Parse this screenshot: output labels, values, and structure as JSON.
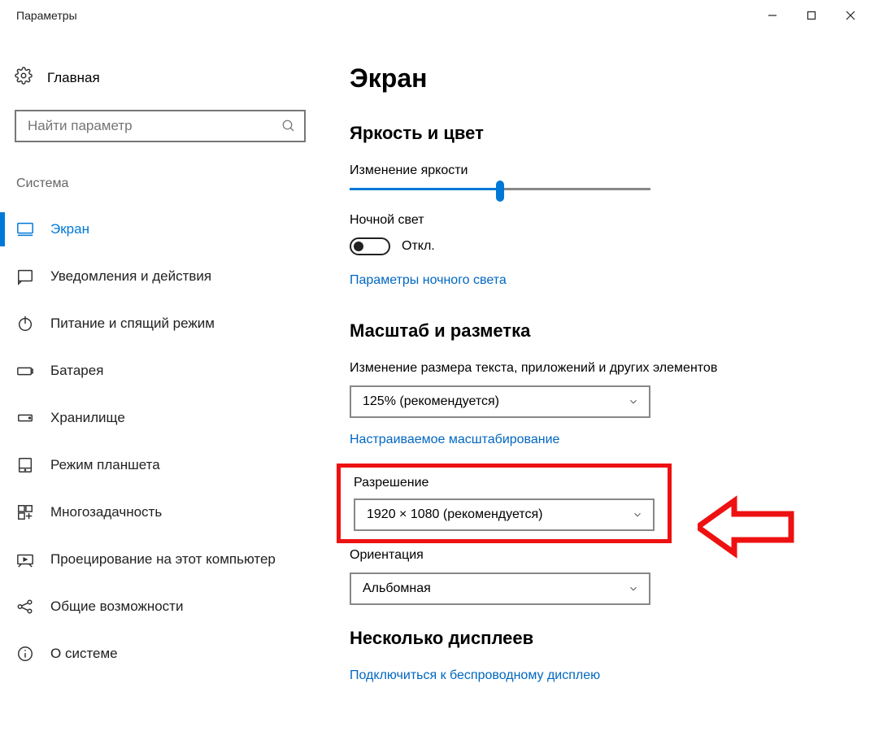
{
  "window": {
    "title": "Параметры"
  },
  "sidebar": {
    "home_label": "Главная",
    "search_placeholder": "Найти параметр",
    "section_label": "Система",
    "items": [
      {
        "id": "display",
        "label": "Экран",
        "icon": "monitor-icon",
        "active": true
      },
      {
        "id": "notifications",
        "label": "Уведомления и действия",
        "icon": "notification-icon"
      },
      {
        "id": "power",
        "label": "Питание и спящий режим",
        "icon": "power-icon"
      },
      {
        "id": "battery",
        "label": "Батарея",
        "icon": "battery-icon"
      },
      {
        "id": "storage",
        "label": "Хранилище",
        "icon": "storage-icon"
      },
      {
        "id": "tablet",
        "label": "Режим планшета",
        "icon": "tablet-icon"
      },
      {
        "id": "multitask",
        "label": "Многозадачность",
        "icon": "multitask-icon"
      },
      {
        "id": "projecting",
        "label": "Проецирование на этот компьютер",
        "icon": "projecting-icon"
      },
      {
        "id": "shared",
        "label": "Общие возможности",
        "icon": "shared-icon"
      },
      {
        "id": "about",
        "label": "О системе",
        "icon": "about-icon"
      }
    ]
  },
  "main": {
    "page_title": "Экран",
    "brightness_section": "Яркость и цвет",
    "brightness_label": "Изменение яркости",
    "brightness_percent": 50,
    "night_light_label": "Ночной свет",
    "night_light_state": "Откл.",
    "night_light_settings_link": "Параметры ночного света",
    "scale_section": "Масштаб и разметка",
    "scale_label": "Изменение размера текста, приложений и других элементов",
    "scale_value": "125% (рекомендуется)",
    "custom_scaling_link": "Настраиваемое масштабирование",
    "resolution_label": "Разрешение",
    "resolution_value": "1920 × 1080 (рекомендуется)",
    "orientation_label": "Ориентация",
    "orientation_value": "Альбомная",
    "multi_display_section": "Несколько дисплеев",
    "wireless_display_link": "Подключиться к беспроводному дисплею"
  }
}
